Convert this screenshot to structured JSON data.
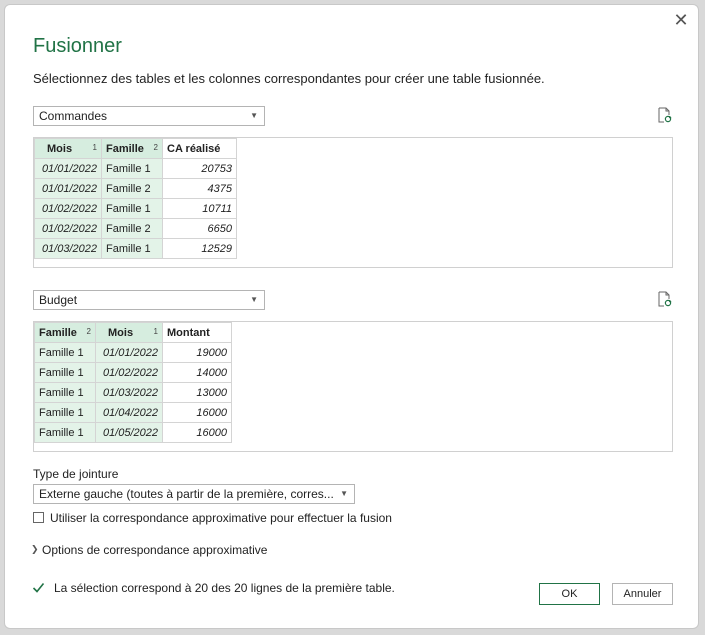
{
  "dialog": {
    "title": "Fusionner",
    "subtitle": "Sélectionnez des tables et les colonnes correspondantes pour créer une table fusionnée.",
    "close_icon": "close-icon"
  },
  "table1": {
    "selected": "Commandes",
    "headers": [
      {
        "label": "Mois",
        "order": "1"
      },
      {
        "label": "Famille",
        "order": "2"
      },
      {
        "label": "CA réalisé",
        "order": ""
      }
    ],
    "rows": [
      [
        "01/01/2022",
        "Famille 1",
        "20753"
      ],
      [
        "01/01/2022",
        "Famille 2",
        "4375"
      ],
      [
        "01/02/2022",
        "Famille 1",
        "10711"
      ],
      [
        "01/02/2022",
        "Famille 2",
        "6650"
      ],
      [
        "01/03/2022",
        "Famille 1",
        "12529"
      ]
    ]
  },
  "table2": {
    "selected": "Budget",
    "headers": [
      {
        "label": "Famille",
        "order": "2"
      },
      {
        "label": "Mois",
        "order": "1"
      },
      {
        "label": "Montant",
        "order": ""
      }
    ],
    "rows": [
      [
        "Famille 1",
        "01/01/2022",
        "19000"
      ],
      [
        "Famille 1",
        "01/02/2022",
        "14000"
      ],
      [
        "Famille 1",
        "01/03/2022",
        "13000"
      ],
      [
        "Famille 1",
        "01/04/2022",
        "16000"
      ],
      [
        "Famille 1",
        "01/05/2022",
        "16000"
      ]
    ]
  },
  "join": {
    "label": "Type de jointure",
    "selected": "Externe gauche (toutes à partir de la première, corres...",
    "fuzzy_label": "Utiliser la correspondance approximative pour effectuer la fusion",
    "fuzzy_checked": false,
    "fuzzy_options": "Options de correspondance approximative"
  },
  "status": {
    "text": "La sélection correspond à 20 des 20 lignes de la première table."
  },
  "buttons": {
    "ok": "OK",
    "cancel": "Annuler"
  },
  "colors": {
    "accent": "#217346",
    "selected_header": "#d6eddf",
    "selected_cell": "#e3f3e8"
  }
}
